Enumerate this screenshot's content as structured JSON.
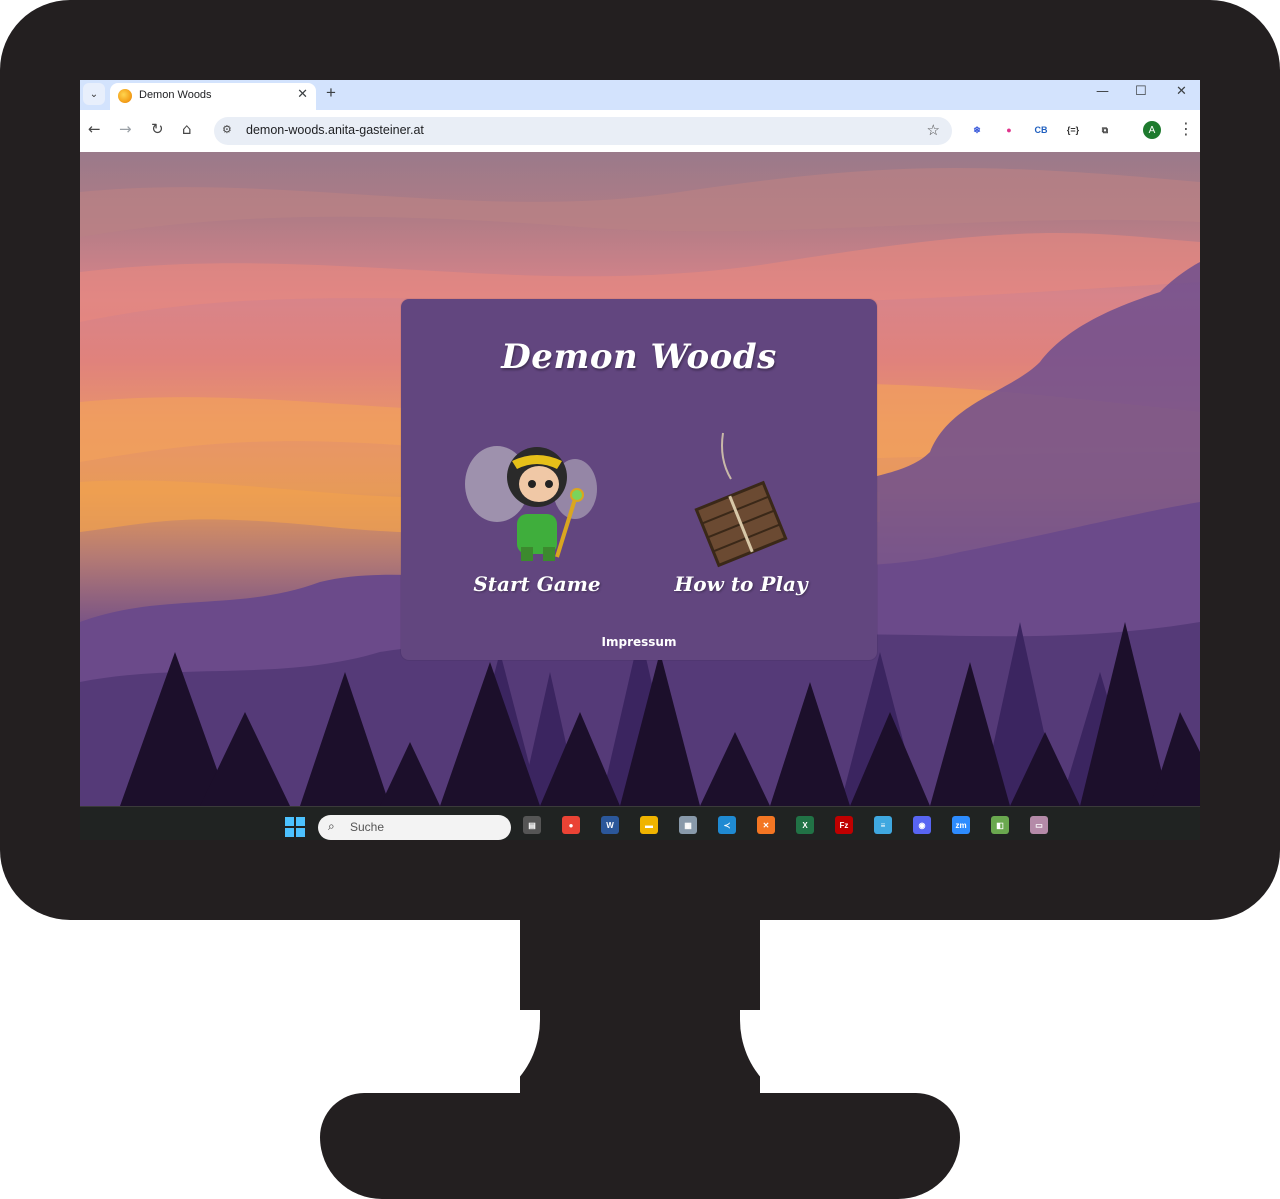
{
  "browser": {
    "tab": {
      "title": "Demon Woods",
      "close": "✕"
    },
    "new_tab": "+",
    "window_controls": {
      "minimize": "—",
      "maximize": "☐",
      "close": "✕"
    },
    "url": "demon-woods.anita-gasteiner.at",
    "nav": {
      "back": "←",
      "forward": "→",
      "reload": "↻",
      "home": "⌂"
    },
    "star": "☆",
    "profile_initial": "A",
    "extensions": [
      {
        "name": "ext-snowflake-icon",
        "label": "❄",
        "color": "#3b5bdb"
      },
      {
        "name": "ext-color-wheel-icon",
        "label": "●",
        "color": "#e0348c"
      },
      {
        "name": "ext-cookie-icon",
        "label": "CB",
        "color": "#1f5fbf"
      },
      {
        "name": "ext-json-icon",
        "label": "{=}",
        "color": "#333333"
      },
      {
        "name": "ext-puzzle-icon",
        "label": "⧉",
        "color": "#474747"
      }
    ]
  },
  "game": {
    "title": "Demon Woods",
    "start_label": "Start Game",
    "howto_label": "How to Play",
    "impressum_label": "Impressum"
  },
  "taskbar": {
    "search_placeholder": "Suche",
    "apps": [
      {
        "name": "task-view-icon",
        "label": "▤",
        "color": "#555555"
      },
      {
        "name": "chrome-icon",
        "label": "●",
        "color": "#ea4335"
      },
      {
        "name": "word-icon",
        "label": "W",
        "color": "#2b579a"
      },
      {
        "name": "file-explorer-icon",
        "label": "▬",
        "color": "#f0b400"
      },
      {
        "name": "calculator-icon",
        "label": "▦",
        "color": "#8899aa"
      },
      {
        "name": "vscode-icon",
        "label": "≺",
        "color": "#1f8ad2"
      },
      {
        "name": "xampp-icon",
        "label": "✕",
        "color": "#f37623"
      },
      {
        "name": "excel-icon",
        "label": "X",
        "color": "#217346"
      },
      {
        "name": "filezilla-icon",
        "label": "Fz",
        "color": "#bf0000"
      },
      {
        "name": "notepad-icon",
        "label": "≡",
        "color": "#3fa8e0"
      },
      {
        "name": "discord-icon",
        "label": "◉",
        "color": "#5865f2"
      },
      {
        "name": "zoom-icon",
        "label": "zm",
        "color": "#2d8cff"
      },
      {
        "name": "app-icon",
        "label": "◧",
        "color": "#6aa84f"
      },
      {
        "name": "media-icon",
        "label": "▭",
        "color": "#b48aa8"
      }
    ]
  },
  "colors": {
    "card": "#62467f",
    "sky_top": "#9a7a8a",
    "forest": "#1c0f2b"
  }
}
